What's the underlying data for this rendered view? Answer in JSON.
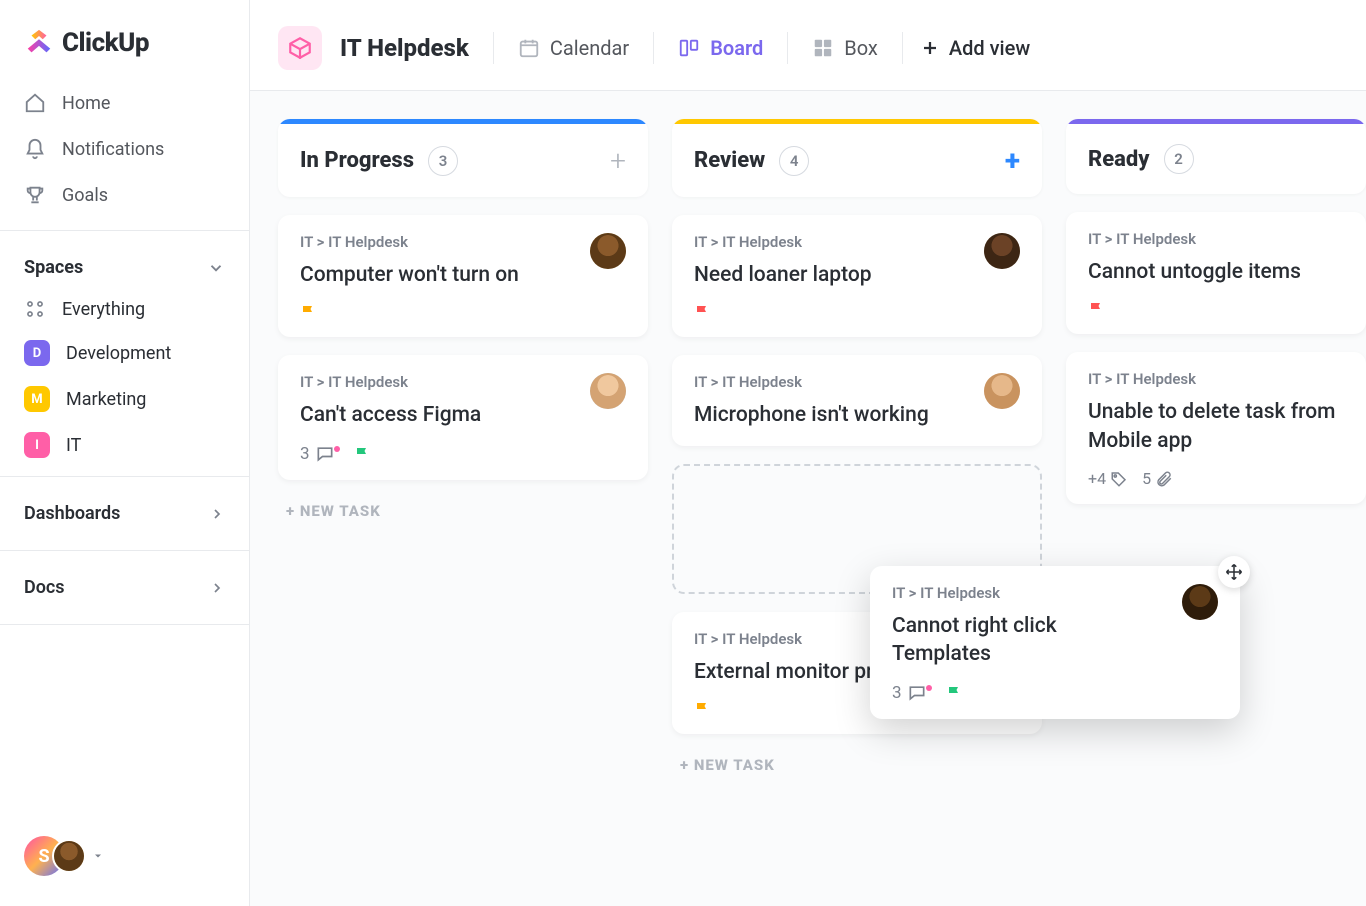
{
  "app": {
    "name": "ClickUp"
  },
  "nav": {
    "home": "Home",
    "notifications": "Notifications",
    "goals": "Goals"
  },
  "spaces": {
    "header": "Spaces",
    "everything": "Everything",
    "items": [
      {
        "letter": "D",
        "label": "Development",
        "color": "#7b68ee"
      },
      {
        "letter": "M",
        "label": "Marketing",
        "color": "#ffc800"
      },
      {
        "letter": "I",
        "label": "IT",
        "color": "#ff5fa7"
      }
    ]
  },
  "links": {
    "dashboards": "Dashboards",
    "docs": "Docs"
  },
  "user": {
    "initial": "S"
  },
  "workspace": {
    "title": "IT Helpdesk"
  },
  "views": {
    "calendar": "Calendar",
    "board": "Board",
    "box": "Box",
    "add": "Add view"
  },
  "columns": [
    {
      "title": "In Progress",
      "count": "3",
      "barColor": "#2d88ff",
      "addStyle": "gray",
      "cards": [
        {
          "crumb": "IT > IT Helpdesk",
          "title": "Computer won't turn on",
          "avatarBg": "#ffe29b",
          "flag": "#ffab00"
        },
        {
          "crumb": "IT > IT Helpdesk",
          "title": "Can't access Figma",
          "avatarBg": "#bfe6ff",
          "comments": "3",
          "flag": "#23c77c"
        }
      ],
      "newTask": "+ NEW TASK"
    },
    {
      "title": "Review",
      "count": "4",
      "barColor": "#ffc800",
      "addStyle": "blue",
      "cards": [
        {
          "crumb": "IT > IT Helpdesk",
          "title": "Need loaner laptop",
          "avatarBg": "#d9c4a5",
          "flag": "#ff5252"
        },
        {
          "crumb": "IT > IT Helpdesk",
          "title": "Microphone isn't working",
          "avatarBg": "#efd9c7"
        }
      ],
      "dropzone": true,
      "extra": {
        "crumb": "IT > IT Helpdesk",
        "title": "External monitor problem",
        "flag": "#ffab00"
      },
      "newTask": "+ NEW TASK"
    },
    {
      "title": "Ready",
      "count": "2",
      "barColor": "#7b68ee",
      "addStyle": "none",
      "cards": [
        {
          "crumb": "IT > IT Helpdesk",
          "title": "Cannot untoggle items",
          "flag": "#ff5252"
        },
        {
          "crumb": "IT > IT Helpdesk",
          "title": "Unable to delete task from Mobile app",
          "tagCount": "+4",
          "attachCount": "5"
        }
      ]
    }
  ],
  "dragCard": {
    "crumb": "IT > IT Helpdesk",
    "title": "Cannot right click Templates",
    "avatarBg": "#e8d5c4",
    "comments": "3",
    "flag": "#23c77c"
  }
}
